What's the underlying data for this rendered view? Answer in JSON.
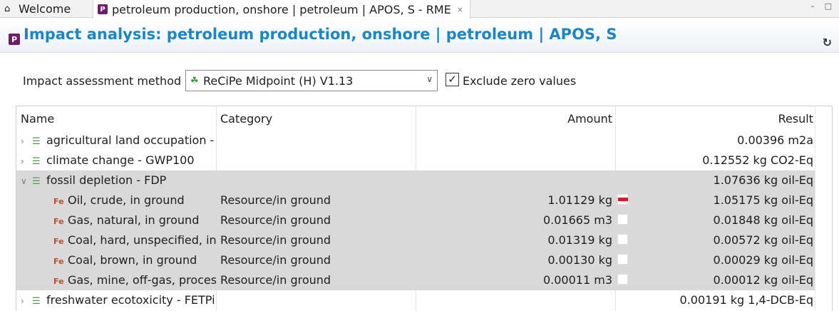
{
  "tabs": {
    "welcome": {
      "label": "Welcome"
    },
    "active": {
      "label": "petroleum production, onshore | petroleum | APOS, S - RME"
    }
  },
  "header": {
    "title": "Impact analysis: petroleum production, onshore | petroleum | APOS, S"
  },
  "method": {
    "label": "Impact assessment method",
    "selected": "ReCiPe Midpoint (H) V1.13",
    "exclude_zero_label": "Exclude zero values",
    "exclude_zero_checked": true
  },
  "table": {
    "columns": {
      "name": "Name",
      "category": "Category",
      "amount": "Amount",
      "result": "Result"
    },
    "rows": [
      {
        "level": 0,
        "expanded": false,
        "name": "agricultural land occupation -",
        "category": "",
        "amount": "",
        "result": "0.00396 m2a"
      },
      {
        "level": 0,
        "expanded": false,
        "name": "climate change - GWP100",
        "category": "",
        "amount": "",
        "result": "0.12552 kg CO2-Eq"
      },
      {
        "level": 0,
        "expanded": true,
        "name": "fossil depletion - FDP",
        "category": "",
        "amount": "",
        "result": "1.07636 kg oil-Eq"
      },
      {
        "level": 1,
        "name": "Oil, crude, in ground",
        "category": "Resource/in ground",
        "amount": "1.01129 kg",
        "share": 0.98,
        "result": "1.05175 kg oil-Eq"
      },
      {
        "level": 1,
        "name": "Gas, natural, in ground",
        "category": "Resource/in ground",
        "amount": "0.01665 m3",
        "share": 0.017,
        "result": "0.01848 kg oil-Eq"
      },
      {
        "level": 1,
        "name": "Coal, hard, unspecified, in",
        "category": "Resource/in ground",
        "amount": "0.01319 kg",
        "share": 0.005,
        "result": "0.00572 kg oil-Eq"
      },
      {
        "level": 1,
        "name": "Coal, brown, in ground",
        "category": "Resource/in ground",
        "amount": "0.00130 kg",
        "share": 0.0003,
        "result": "0.00029 kg oil-Eq"
      },
      {
        "level": 1,
        "name": "Gas, mine, off-gas, proces",
        "category": "Resource/in ground",
        "amount": "0.00011 m3",
        "share": 0.0001,
        "result": "0.00012 kg oil-Eq"
      },
      {
        "level": 0,
        "expanded": false,
        "name": "freshwater ecotoxicity - FETPi",
        "category": "",
        "amount": "",
        "result": "0.00191 kg 1,4-DCB-Eq"
      }
    ]
  },
  "colors": {
    "title": "#1b86c7",
    "bar": "#e0162b",
    "selected_row": "#d9d9d9"
  }
}
